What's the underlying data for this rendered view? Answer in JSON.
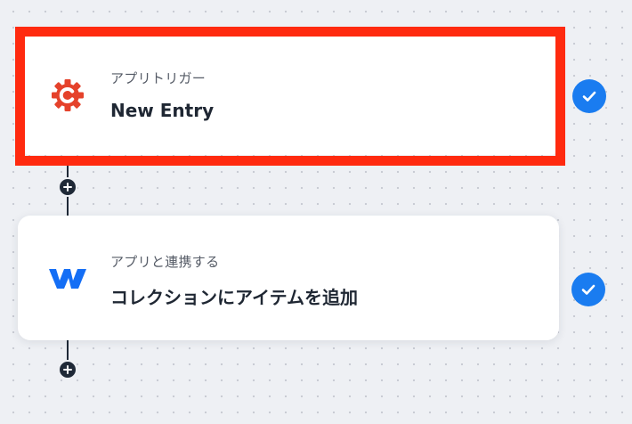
{
  "flow": {
    "steps": [
      {
        "kind_label": "アプリトリガー",
        "title": "New Entry",
        "app_icon": "craft-cms-logo-icon",
        "status": "completed",
        "highlighted": true
      },
      {
        "kind_label": "アプリと連携する",
        "title": "コレクションにアイテムを追加",
        "app_icon": "webflow-logo-icon",
        "status": "completed",
        "highlighted": false
      }
    ]
  },
  "colors": {
    "background": "#eef0f4",
    "highlight": "#ff2a0f",
    "check": "#1a7cf0",
    "craft_brand": "#e5422b",
    "webflow_brand": "#146ef5",
    "connector": "#1f2937"
  }
}
